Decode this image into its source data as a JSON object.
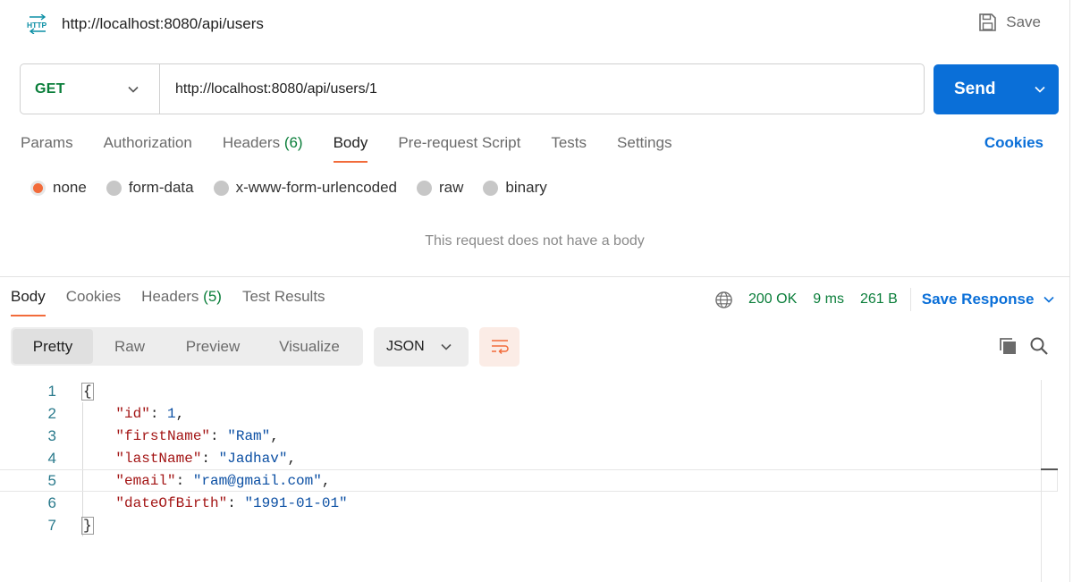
{
  "header": {
    "icon": "http-icon",
    "title": "http://localhost:8080/api/users",
    "save_label": "Save"
  },
  "request": {
    "method": "GET",
    "url": "http://localhost:8080/api/users/1",
    "send_label": "Send",
    "tabs": [
      {
        "label": "Params"
      },
      {
        "label": "Authorization"
      },
      {
        "label": "Headers",
        "count": "(6)"
      },
      {
        "label": "Body",
        "active": true
      },
      {
        "label": "Pre-request Script"
      },
      {
        "label": "Tests"
      },
      {
        "label": "Settings"
      }
    ],
    "cookies_label": "Cookies",
    "body_types": [
      {
        "label": "none",
        "selected": true
      },
      {
        "label": "form-data"
      },
      {
        "label": "x-www-form-urlencoded"
      },
      {
        "label": "raw"
      },
      {
        "label": "binary"
      }
    ],
    "empty_body_message": "This request does not have a body"
  },
  "response": {
    "tabs": [
      {
        "label": "Body",
        "active": true
      },
      {
        "label": "Cookies"
      },
      {
        "label": "Headers",
        "count": "(5)"
      },
      {
        "label": "Test Results"
      }
    ],
    "status": "200 OK",
    "time": "9 ms",
    "size": "261 B",
    "save_response_label": "Save Response",
    "view_modes": [
      "Pretty",
      "Raw",
      "Preview",
      "Visualize"
    ],
    "active_view": "Pretty",
    "format": "JSON",
    "code_lines": [
      {
        "n": "1",
        "text": "{"
      },
      {
        "n": "2",
        "text": "    \"id\": 1,"
      },
      {
        "n": "3",
        "text": "    \"firstName\": \"Ram\","
      },
      {
        "n": "4",
        "text": "    \"lastName\": \"Jadhav\","
      },
      {
        "n": "5",
        "text": "    \"email\": \"ram@gmail.com\","
      },
      {
        "n": "6",
        "text": "    \"dateOfBirth\": \"1991-01-01\""
      },
      {
        "n": "7",
        "text": "}"
      }
    ]
  },
  "colors": {
    "accent_orange": "#f26b3a",
    "brand_blue": "#0a6fd8",
    "status_green": "#0a7e3a",
    "json_key": "#a31515",
    "json_value": "#0b4fa3"
  }
}
